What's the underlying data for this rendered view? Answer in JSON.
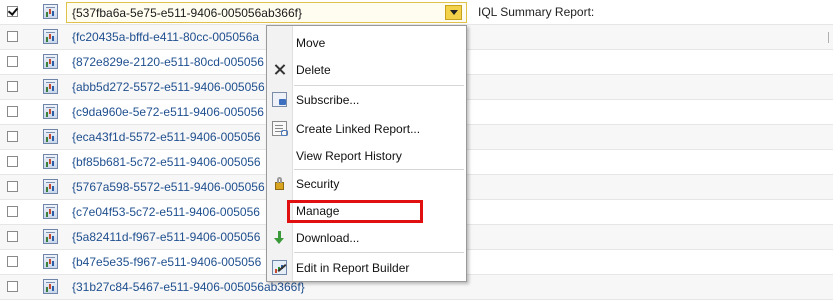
{
  "report_list": {
    "rows": [
      {
        "id": "{537fba6a-5e75-e511-9406-005056ab366f}",
        "checked": true,
        "description": "IQL Summary Report:"
      },
      {
        "id": "{fc20435a-bffd-e411-80cc-005056a",
        "checked": false,
        "description": ""
      },
      {
        "id": "{872e829e-2120-e511-80cd-005056",
        "checked": false,
        "description": ""
      },
      {
        "id": "{abb5d272-5572-e511-9406-005056",
        "checked": false,
        "description": ""
      },
      {
        "id": "{c9da960e-5e72-e511-9406-005056",
        "checked": false,
        "description": ""
      },
      {
        "id": "{eca43f1d-5572-e511-9406-005056",
        "checked": false,
        "description": ""
      },
      {
        "id": "{bf85b681-5c72-e511-9406-005056",
        "checked": false,
        "description": ""
      },
      {
        "id": "{5767a598-5572-e511-9406-005056",
        "checked": false,
        "description": ""
      },
      {
        "id": "{c7e04f53-5c72-e511-9406-005056",
        "checked": false,
        "description": ""
      },
      {
        "id": "{5a82411d-f967-e511-9406-005056",
        "checked": false,
        "description": ""
      },
      {
        "id": "{b47e5e35-f967-e511-9406-005056",
        "checked": false,
        "description": ""
      },
      {
        "id": "{31b27c84-5467-e511-9406-005056ab366f}",
        "checked": false,
        "description": ""
      }
    ]
  },
  "context_menu": {
    "items": [
      {
        "label": "Move",
        "icon": ""
      },
      {
        "label": "Delete",
        "icon": "delete-x-icon"
      },
      {
        "label": "Subscribe...",
        "icon": "subscribe-icon"
      },
      {
        "label": "Create Linked Report...",
        "icon": "linked-report-icon"
      },
      {
        "label": "View Report History",
        "icon": ""
      },
      {
        "label": "Security",
        "icon": "lock-icon"
      },
      {
        "label": "Manage",
        "icon": ""
      },
      {
        "label": "Download...",
        "icon": "download-arrow-icon"
      },
      {
        "label": "Edit in Report Builder",
        "icon": "report-builder-icon"
      }
    ]
  },
  "colors": {
    "highlight": "#e01010",
    "link": "#1f4f8f",
    "dropdown": "#f3d24a"
  }
}
